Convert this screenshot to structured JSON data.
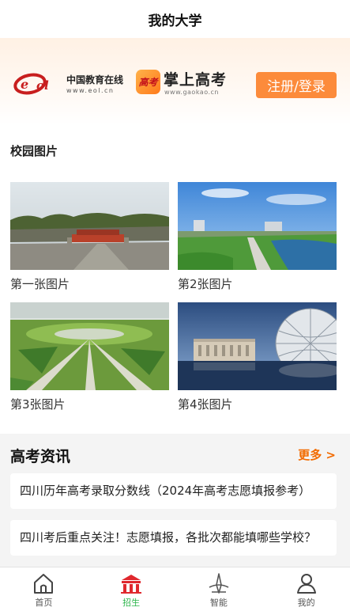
{
  "header": {
    "title": "我的大学"
  },
  "banner": {
    "eol_name": "中国教育在线",
    "eol_url": "www.eol.cn",
    "gaokao_badge": "高考",
    "gaokao_name": "掌上高考",
    "gaokao_url": "www.gaokao.cn",
    "login_label": "注册/登录"
  },
  "campus": {
    "title": "校园图片",
    "photos": [
      {
        "caption": "第一张图片"
      },
      {
        "caption": "第2张图片"
      },
      {
        "caption": "第3张图片"
      },
      {
        "caption": "第4张图片"
      }
    ]
  },
  "news": {
    "title": "高考资讯",
    "more": "更多 >",
    "items": [
      {
        "text": "四川历年高考录取分数线（2024年高考志愿填报参考）"
      },
      {
        "text": "四川考后重点关注！志愿填报，各批次都能填哪些学校？"
      }
    ]
  },
  "tabbar": {
    "items": [
      {
        "label": "首页",
        "icon": "home-icon"
      },
      {
        "label": "招生",
        "icon": "building-icon"
      },
      {
        "label": "智能",
        "icon": "compass-icon"
      },
      {
        "label": "我的",
        "icon": "user-icon"
      }
    ],
    "active_color": "#2bb54a",
    "active_icon_color": "#e0282e"
  },
  "colors": {
    "accent": "#fc8b3b",
    "more": "#f26b00"
  }
}
